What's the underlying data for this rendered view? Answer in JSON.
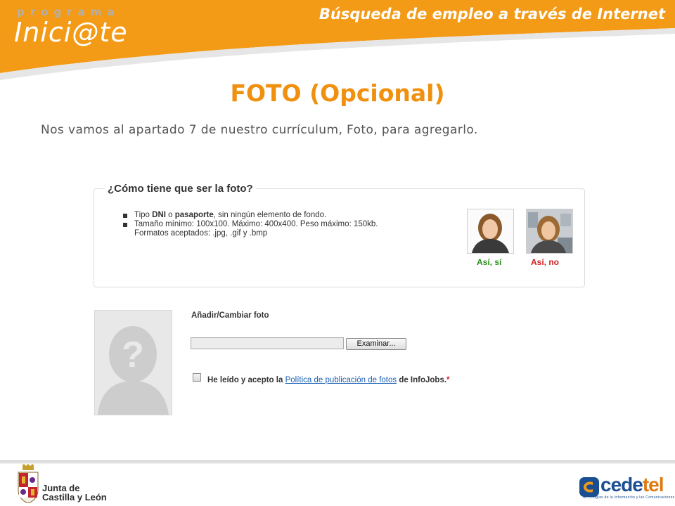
{
  "header": {
    "brand_top": "programa",
    "brand_main": "Inici@te",
    "title": "Búsqueda de empleo a través de Internet"
  },
  "slide": {
    "title": "FOTO (Opcional)",
    "intro": "Nos vamos al apartado 7 de nuestro currículum, Foto, para agregarlo."
  },
  "requirements": {
    "title": "¿Cómo tiene que ser la foto?",
    "item1_pre": "Tipo ",
    "item1_b1": "DNI",
    "item1_mid": " o ",
    "item1_b2": "pasaporte",
    "item1_post": ", sin ningún elemento de fondo.",
    "item2": "Tamaño mínimo: 100x100. Máximo: 400x400. Peso máximo: 150kb.",
    "item3": "Formatos aceptados: .jpg, .gif y .bmp",
    "good_caption": "Así, sí",
    "bad_caption": "Así, no"
  },
  "upload": {
    "title": "Añadir/Cambiar foto",
    "browse_label": "Examinar...",
    "file_value": "",
    "accept_pre": "He leído y acepto la ",
    "policy_link": "Política de publicación de fotos",
    "accept_post": " de InfoJobs.",
    "required_mark": "*",
    "checked": false
  },
  "footer": {
    "jcyl_line1": "Junta de",
    "jcyl_line2": "Castilla y León",
    "cedetel_a": "cede",
    "cedetel_b": "tel",
    "cedetel_sub": "Tecnologías de la Información y las Comunicaciones"
  },
  "colors": {
    "accent_orange": "#f0900f",
    "header_orange": "#f39a16",
    "ok_green": "#2f8f1f",
    "no_red": "#cc2222",
    "link_blue": "#1a5fb4"
  },
  "icons": {
    "avatar": "person-question-icon",
    "checkbox": "checkbox-icon",
    "coat_of_arms": "coat-of-arms-icon",
    "cedetel_logo": "cedetel-logo-icon"
  }
}
